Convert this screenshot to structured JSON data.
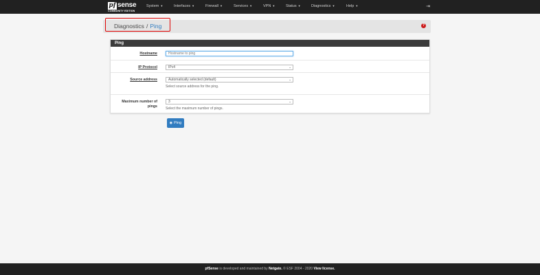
{
  "brand": {
    "mark": "pf",
    "name": "sense",
    "edition": "COMMUNITY EDITION"
  },
  "nav": [
    {
      "label": "System"
    },
    {
      "label": "Interfaces"
    },
    {
      "label": "Firewall"
    },
    {
      "label": "Services"
    },
    {
      "label": "VPN"
    },
    {
      "label": "Status"
    },
    {
      "label": "Diagnostics"
    },
    {
      "label": "Help"
    }
  ],
  "breadcrumb": {
    "section": "Diagnostics",
    "separator": "/",
    "page": "Ping"
  },
  "panel": {
    "title": "Ping"
  },
  "form": {
    "hostname": {
      "label": "Hostname",
      "value": "",
      "placeholder": "Hostname to ping"
    },
    "ip_protocol": {
      "label": "IP Protocol",
      "selected": "IPv4"
    },
    "source_address": {
      "label": "Source address",
      "selected": "Automatically selected (default)",
      "help": "Select source address for the ping."
    },
    "max_pings": {
      "label": "Maximum number of pings",
      "selected": "3",
      "help": "Select the maximum number of pings."
    }
  },
  "ping_button": {
    "label": "Ping"
  },
  "footer": {
    "brand": "pfSense",
    "text1": " is developed and maintained by ",
    "company": "Netgate.",
    "text2": " © ESF 2004 - 2020 ",
    "license": "View license."
  }
}
